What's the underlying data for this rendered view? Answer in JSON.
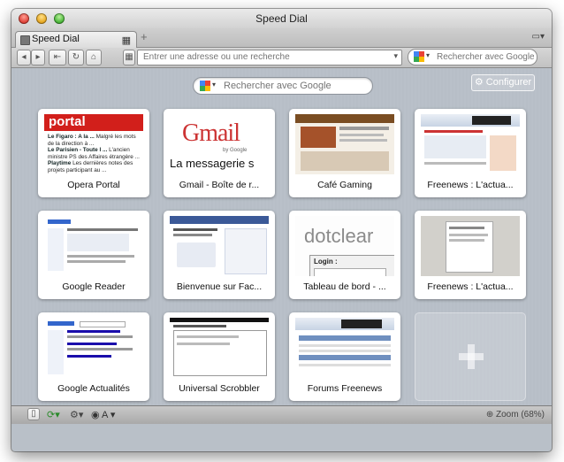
{
  "window": {
    "title": "Speed Dial"
  },
  "tab": {
    "label": "Speed Dial"
  },
  "toolbar": {
    "address_placeholder": "Entrer une adresse ou une recherche",
    "search_placeholder": "Rechercher avec Google"
  },
  "speeddial": {
    "search_placeholder": "Rechercher avec Google",
    "configure_label": "Configurer",
    "tiles": [
      {
        "label": "Opera Portal",
        "thumb": "opera-portal"
      },
      {
        "label": "Gmail - Boîte de r...",
        "thumb": "gmail"
      },
      {
        "label": "Café Gaming",
        "thumb": "cafe-gaming"
      },
      {
        "label": "Freenews : L'actua...",
        "thumb": "freenews"
      },
      {
        "label": "Google Reader",
        "thumb": "google-reader"
      },
      {
        "label": "Bienvenue sur Fac...",
        "thumb": "facebook"
      },
      {
        "label": "Tableau de bord - ...",
        "thumb": "dotclear"
      },
      {
        "label": "Freenews : L'actua...",
        "thumb": "freenews-2"
      },
      {
        "label": "Google Actualités",
        "thumb": "google-news"
      },
      {
        "label": "Universal Scrobbler",
        "thumb": "universal-scrobbler"
      },
      {
        "label": "Forums Freenews",
        "thumb": "forums-freenews"
      }
    ]
  },
  "thumbs": {
    "portal": {
      "brand": "portal",
      "lines": [
        {
          "bold": "Le Figaro : A la ...",
          "text": "Malgré les mots de la direction à ..."
        },
        {
          "bold": "Le Parisien - Toute l ...",
          "text": "L'ancien ministre PS des Affaires étrangère ..."
        },
        {
          "bold": "Playtime",
          "text": "Les dernières notes des projets participant au ..."
        }
      ]
    },
    "gmail": {
      "logo": "Gmail",
      "by": "by Google",
      "tagline": "La messagerie s"
    },
    "dotclear": {
      "logo": "dotclear",
      "login": "Login :"
    }
  },
  "statusbar": {
    "zoom": "Zoom (68%)"
  }
}
